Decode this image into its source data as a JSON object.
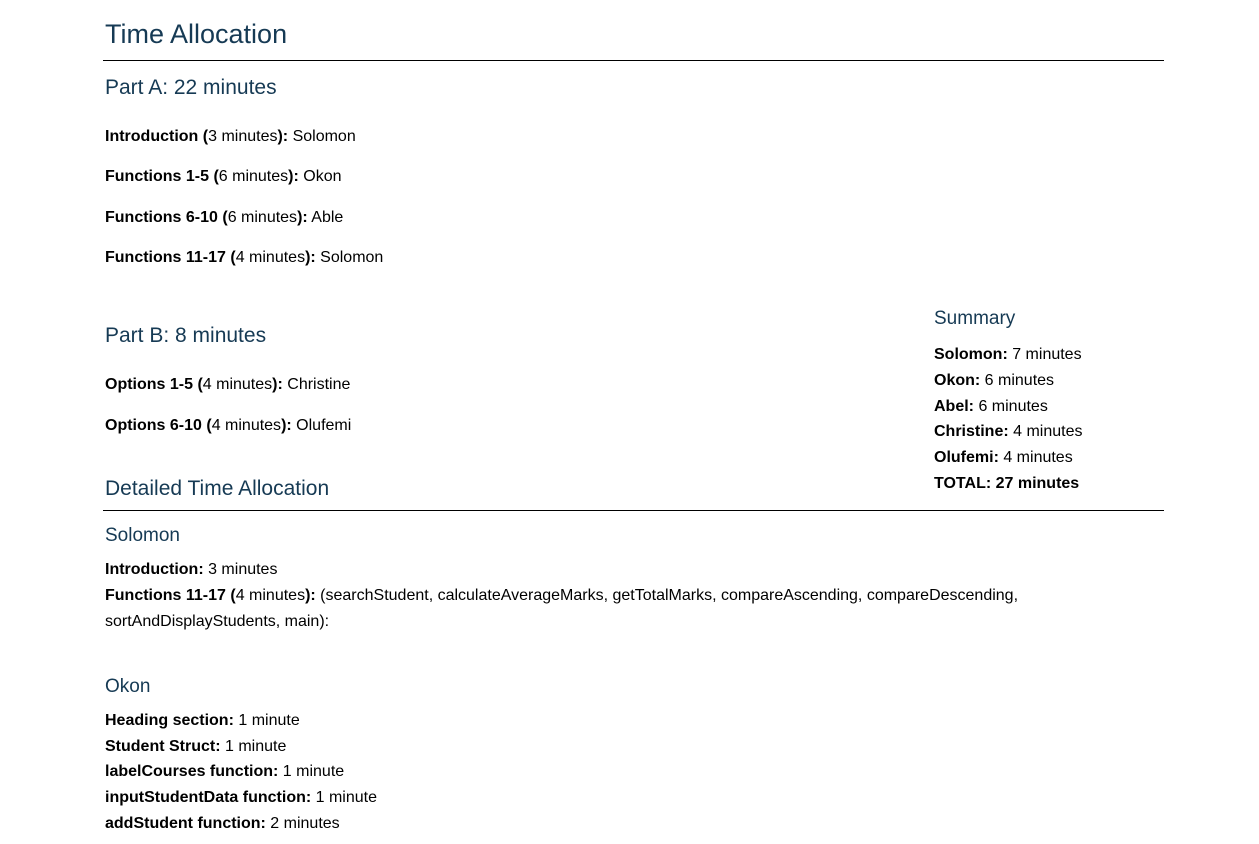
{
  "title": "Time Allocation",
  "partA": {
    "heading": "Part A: 22 minutes",
    "items": [
      {
        "pre": "Introduction (",
        "minutes": "3 minutes",
        "post": "):",
        "person": " Solomon"
      },
      {
        "pre": "Functions 1-5 (",
        "minutes": "6 minutes",
        "post": "):",
        "person": " Okon"
      },
      {
        "pre": "Functions 6-10 (",
        "minutes": "6 minutes",
        "post": "):",
        "person": " Able"
      },
      {
        "pre": "Functions 11-17 (",
        "minutes": "4 minutes",
        "post": "):",
        "person": " Solomon"
      }
    ]
  },
  "partB": {
    "heading": "Part B: 8 minutes",
    "items": [
      {
        "pre": "Options 1-5 (",
        "minutes": "4 minutes",
        "post": "):",
        "person": " Christine"
      },
      {
        "pre": "Options 6-10 (",
        "minutes": "4 minutes",
        "post": "):",
        "person": " Olufemi"
      }
    ]
  },
  "summary": {
    "heading": "Summary",
    "rows": [
      {
        "name": "Solomon:",
        "value": " 7 minutes"
      },
      {
        "name": "Okon:",
        "value": " 6 minutes"
      },
      {
        "name": "Abel:",
        "value": " 6 minutes"
      },
      {
        "name": "Christine:",
        "value": " 4 minutes"
      },
      {
        "name": "Olufemi:",
        "value": " 4 minutes"
      }
    ],
    "total": "TOTAL: 27 minutes"
  },
  "detailed": {
    "heading": "Detailed Time Allocation",
    "solomon": {
      "heading": "Solomon",
      "intro_label": "Introduction:",
      "intro_value": " 3 minutes",
      "func_pre": "Functions 11-17 (",
      "func_minutes": "4 minutes",
      "func_post": "):",
      "func_list": " (searchStudent, calculateAverageMarks, getTotalMarks, compareAscending, compareDescending, sortAndDisplayStudents, main):"
    },
    "okon": {
      "heading": "Okon",
      "rows": [
        {
          "label": "Heading section:",
          "value": " 1 minute"
        },
        {
          "label": "Student Struct:",
          "value": " 1 minute"
        },
        {
          "label": "labelCourses function:",
          "value": " 1 minute"
        },
        {
          "label": "inputStudentData function:",
          "value": " 1 minute"
        },
        {
          "label": "addStudent function:",
          "value": " 2 minutes"
        }
      ]
    }
  }
}
